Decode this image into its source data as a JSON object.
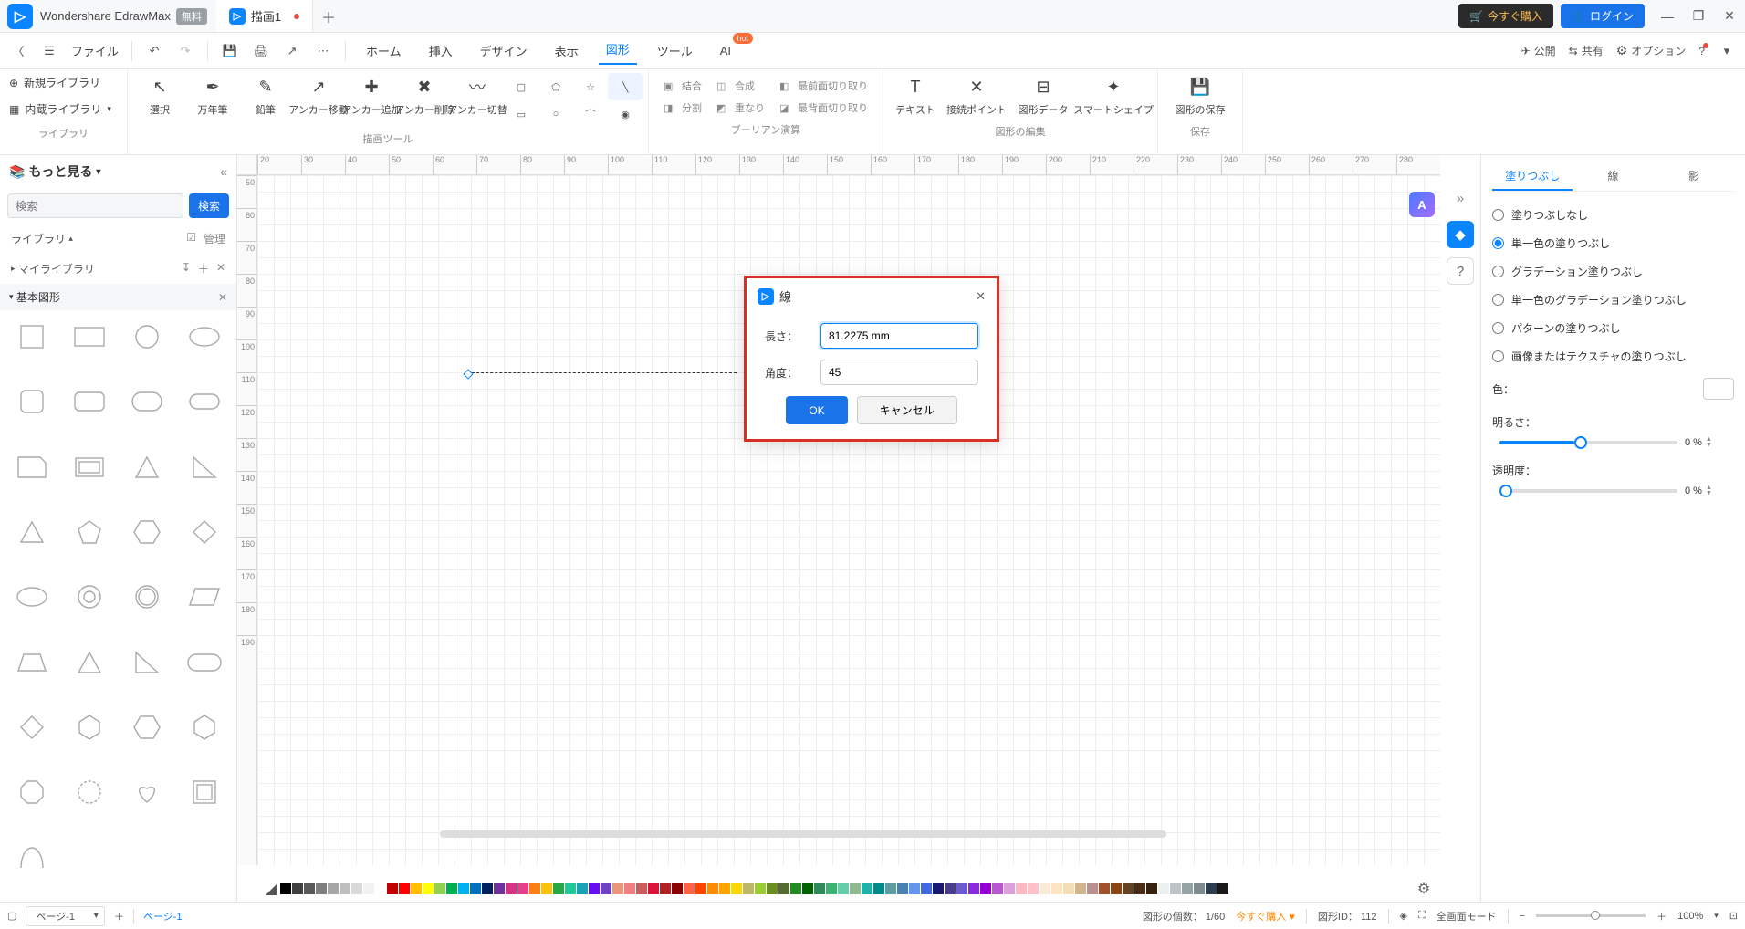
{
  "app": {
    "title": "Wondershare EdrawMax",
    "badge": "無料"
  },
  "tab": {
    "name": "描画1"
  },
  "titlebar": {
    "buy": "今すぐ購入",
    "login": "ログイン"
  },
  "quick": {
    "file": "ファイル",
    "menu": {
      "home": "ホーム",
      "insert": "挿入",
      "design": "デザイン",
      "view": "表示",
      "shape": "図形",
      "tool": "ツール",
      "ai": "AI",
      "hot": "hot"
    },
    "right": {
      "publish": "公開",
      "share": "共有",
      "options": "オプション"
    }
  },
  "ribbon": {
    "lib": {
      "new": "新規ライブラリ",
      "builtin": "内蔵ライブラリ",
      "label": "ライブラリ"
    },
    "draw": {
      "select": "選択",
      "fountain": "万年筆",
      "pencil": "鉛筆",
      "anchor_move": "アンカー移動",
      "anchor_add": "アンカー追加",
      "anchor_del": "アンカー削除",
      "anchor_switch": "アンカー切替",
      "label": "描画ツール"
    },
    "bool": {
      "combine": "結合",
      "compose": "合成",
      "front": "最前面切り取り",
      "split": "分割",
      "overlap": "重なり",
      "back": "最背面切り取り",
      "label": "ブーリアン演算"
    },
    "edit": {
      "text": "テキスト",
      "connect": "接続ポイント",
      "shapedata": "図形データ",
      "smart": "スマートシェイプ",
      "label": "図形の編集"
    },
    "save": {
      "save": "図形の保存",
      "label": "保存"
    }
  },
  "left": {
    "more": "もっと見る",
    "search_ph": "検索",
    "search_btn": "検索",
    "lib_label": "ライブラリ",
    "manage": "管理",
    "mylib": "マイライブラリ",
    "basic": "基本図形"
  },
  "dialog": {
    "title": "線",
    "length_label": "長さ：",
    "length": "81.2275 mm",
    "angle_label": "角度：",
    "angle": "45",
    "ok": "OK",
    "cancel": "キャンセル"
  },
  "right": {
    "tabs": {
      "fill": "塗りつぶし",
      "line": "線",
      "shadow": "影"
    },
    "fill": {
      "none": "塗りつぶしなし",
      "solid": "単一色の塗りつぶし",
      "gradient": "グラデーション塗りつぶし",
      "solid_grad": "単一色のグラデーション塗りつぶし",
      "pattern": "パターンの塗りつぶし",
      "image": "画像またはテクスチャの塗りつぶし"
    },
    "color_label": "色：",
    "brightness_label": "明るさ：",
    "brightness": "0 %",
    "opacity_label": "透明度：",
    "opacity": "0 %"
  },
  "ruler_h": [
    "20",
    "30",
    "40",
    "50",
    "60",
    "70",
    "80",
    "90",
    "100",
    "110",
    "120",
    "130",
    "140",
    "150",
    "160",
    "170",
    "180",
    "190",
    "200",
    "210",
    "220",
    "230",
    "240",
    "250",
    "260",
    "270",
    "280"
  ],
  "ruler_v": [
    "50",
    "60",
    "70",
    "80",
    "90",
    "100",
    "110",
    "120",
    "130",
    "140",
    "150",
    "160",
    "170",
    "180",
    "190"
  ],
  "colors": [
    "#000000",
    "#404040",
    "#595959",
    "#7f7f7f",
    "#a6a6a6",
    "#bfbfbf",
    "#d9d9d9",
    "#f2f2f2",
    "#ffffff",
    "#c00000",
    "#ff0000",
    "#ffc000",
    "#ffff00",
    "#92d050",
    "#00b050",
    "#00b0f0",
    "#0070c0",
    "#002060",
    "#7030a0",
    "#d63384",
    "#e83e8c",
    "#fd7e14",
    "#ffc107",
    "#28a745",
    "#20c997",
    "#17a2b8",
    "#6610f2",
    "#6f42c1",
    "#e9967a",
    "#f08080",
    "#cd5c5c",
    "#dc143c",
    "#b22222",
    "#8b0000",
    "#ff6347",
    "#ff4500",
    "#ff8c00",
    "#ffa500",
    "#ffd700",
    "#bdb76b",
    "#9acd32",
    "#6b8e23",
    "#556b2f",
    "#228b22",
    "#006400",
    "#2e8b57",
    "#3cb371",
    "#66cdaa",
    "#8fbc8f",
    "#20b2aa",
    "#008b8b",
    "#5f9ea0",
    "#4682b4",
    "#6495ed",
    "#4169e1",
    "#191970",
    "#483d8b",
    "#6a5acd",
    "#8a2be2",
    "#9400d3",
    "#ba55d3",
    "#dda0dd",
    "#ffb6c1",
    "#ffc0cb",
    "#faebd7",
    "#ffe4c4",
    "#f5deb3",
    "#d2b48c",
    "#bc8f8f",
    "#a0522d",
    "#8b4513",
    "#654321",
    "#4a2c17",
    "#36220f",
    "#ecf0f1",
    "#bdc3c7",
    "#95a5a6",
    "#7f8c8d",
    "#2c3e50",
    "#1a1a1a"
  ],
  "status": {
    "page": "ページ-1",
    "page_tab": "ページ-1",
    "shape_count": "図形の個数：",
    "count_val": "1/60",
    "buy": "今すぐ購入",
    "shape_id": "図形ID：",
    "id_val": "112",
    "fullscreen": "全画面モード",
    "zoom": "100%"
  }
}
